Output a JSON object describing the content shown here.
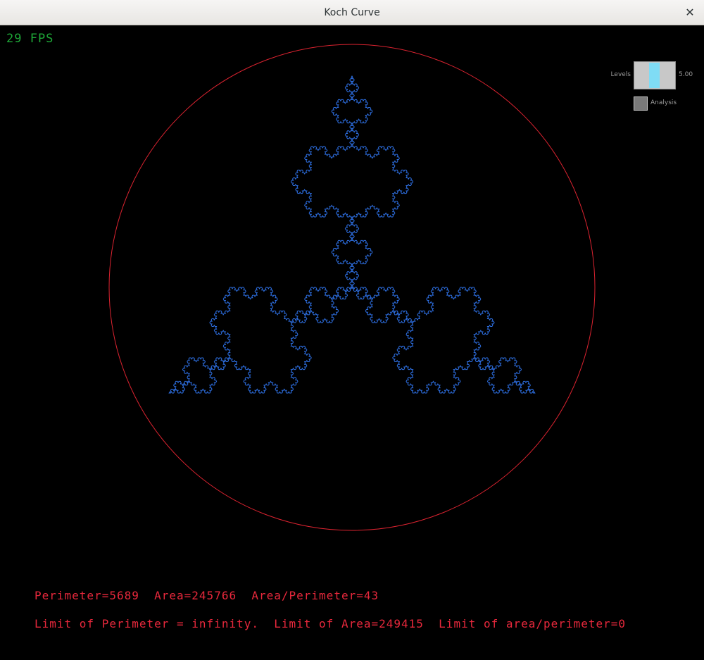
{
  "window": {
    "title": "Koch Curve",
    "close_glyph": "✕"
  },
  "hud": {
    "fps": "29 FPS"
  },
  "controls": {
    "levels_label": "Levels",
    "levels_value": "5.00",
    "analysis_label": "Analysis"
  },
  "stats": {
    "line1": "Perimeter=5689  Area=245766  Area/Perimeter=43",
    "line2": "Limit of Perimeter = infinity.  Limit of Area=249415  Limit of area/perimeter=0"
  },
  "figure": {
    "koch_level": 5,
    "snowflake_color": "#2d6ee0",
    "circle_color": "#dc2330"
  }
}
